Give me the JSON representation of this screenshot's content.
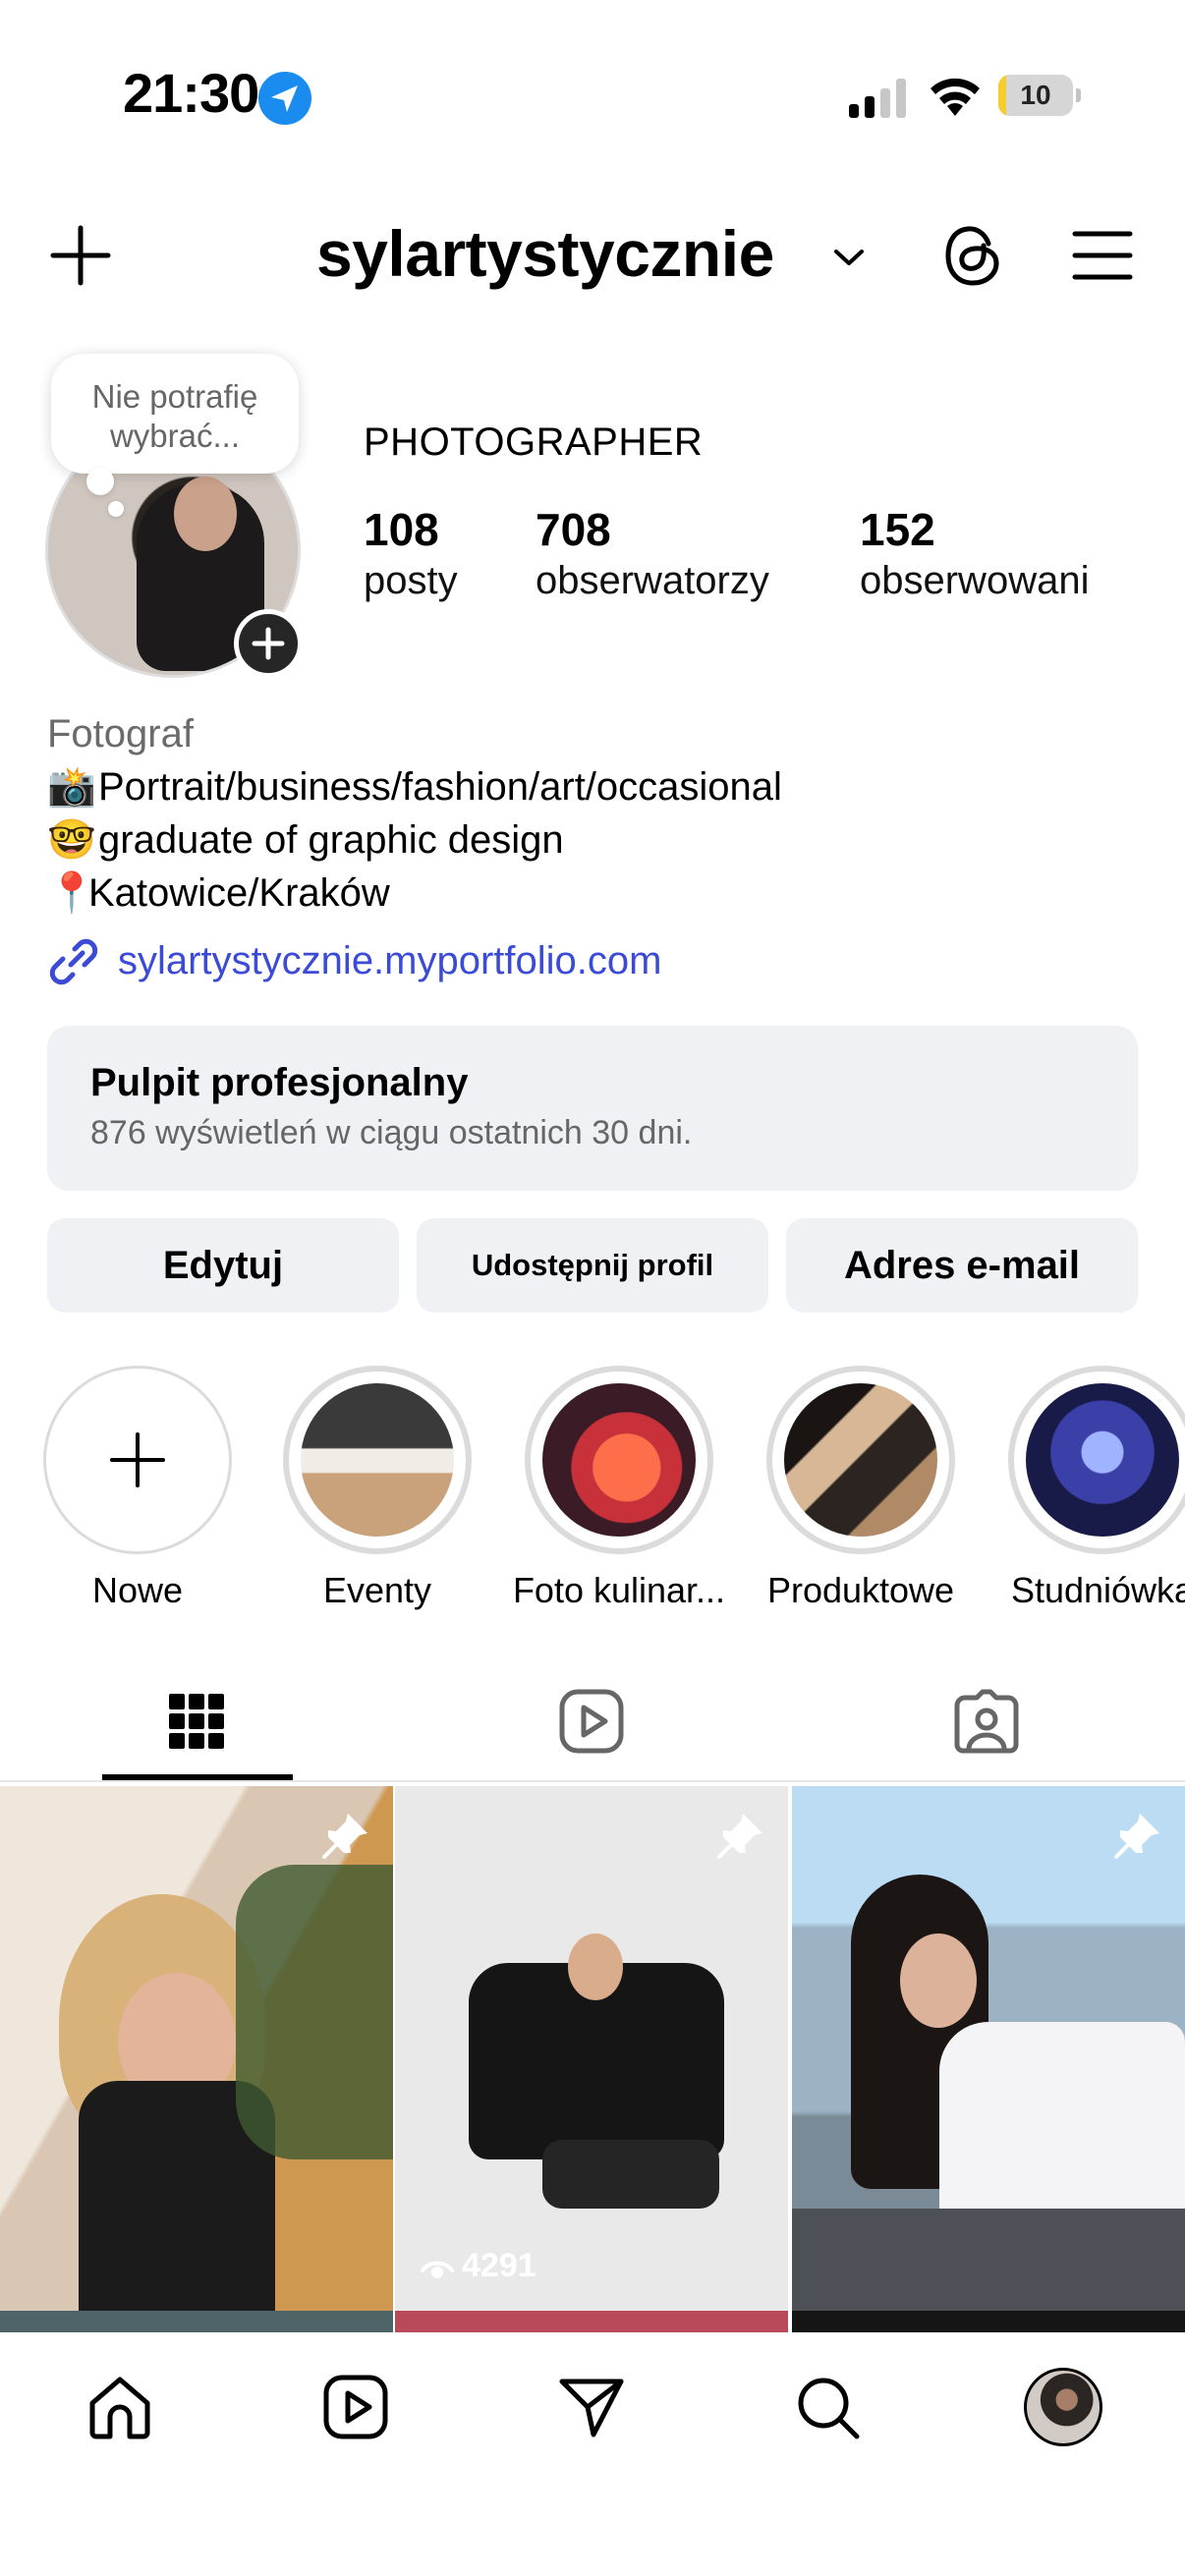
{
  "status_bar": {
    "time": "21:30",
    "battery_level": "10",
    "battery_fraction": 0.1,
    "battery_color": "#f6cd2c",
    "signal_bars_active": 2,
    "signal_bars_total": 4
  },
  "header": {
    "username": "sylartystycznie",
    "icons": [
      "plus-icon",
      "chevron-down-icon",
      "threads-icon",
      "menu-icon"
    ]
  },
  "note": {
    "text_line1": "Nie potrafię",
    "text_line2": "wybrać..."
  },
  "profile": {
    "category": "PHOTOGRAPHER",
    "stats": [
      {
        "value": "108",
        "label": "posty"
      },
      {
        "value": "708",
        "label": "obserwatorzy"
      },
      {
        "value": "152",
        "label": "obserwowani"
      }
    ]
  },
  "bio": {
    "subtitle": "Fotograf",
    "lines": [
      {
        "emoji": "📸",
        "text": "Portrait/business/fashion/art/occasional"
      },
      {
        "emoji": "🤓",
        "text": "graduate of graphic design"
      },
      {
        "emoji": "📍",
        "text": "Katowice/Kraków"
      }
    ],
    "link": "sylartystycznie.myportfolio.com",
    "link_color": "#3b4bd6"
  },
  "dashboard": {
    "title": "Pulpit profesjonalny",
    "subtitle": "876 wyświetleń w ciągu ostatnich 30 dni."
  },
  "buttons": {
    "edit": "Edytuj",
    "share": "Udostępnij profil",
    "email": "Adres e-mail"
  },
  "highlights": [
    {
      "label": "Nowe"
    },
    {
      "label": "Eventy"
    },
    {
      "label": "Foto kulinar..."
    },
    {
      "label": "Produktowe"
    },
    {
      "label": "Studniówka"
    }
  ],
  "tabs": [
    "grid-icon",
    "reels-icon",
    "tagged-icon"
  ],
  "posts": [
    {
      "pinned": true,
      "views": ""
    },
    {
      "pinned": true,
      "views": "4291"
    },
    {
      "pinned": true,
      "views": ""
    }
  ],
  "bottom_nav": [
    "home-icon",
    "reels-icon",
    "messages-icon",
    "search-icon",
    "profile-avatar"
  ]
}
